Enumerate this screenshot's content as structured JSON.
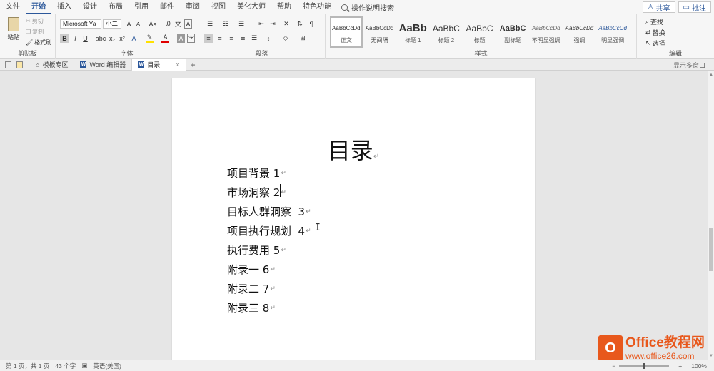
{
  "menu": {
    "tabs": [
      "文件",
      "开始",
      "插入",
      "设计",
      "布局",
      "引用",
      "邮件",
      "审阅",
      "视图",
      "美化大师",
      "帮助",
      "特色功能"
    ],
    "active_tab": "开始",
    "search_label": "操作说明搜索",
    "share_label": "共享",
    "comment_label": "批注"
  },
  "ribbon": {
    "clipboard": {
      "label": "剪贴板",
      "paste": "粘贴",
      "cut": "剪切",
      "copy": "复制",
      "format_painter": "格式刷"
    },
    "font": {
      "label": "字体",
      "family": "Microsoft Ya",
      "size": "小二",
      "aa": "Aa",
      "a_grow": "A",
      "a_shrink": "A"
    },
    "paragraph": {
      "label": "段落"
    },
    "styles": {
      "label": "样式",
      "items": [
        {
          "sample": "AaBbCcDd",
          "name": "正文"
        },
        {
          "sample": "AaBbCcDd",
          "name": "无间隔"
        },
        {
          "sample": "AaBb",
          "name": "标题 1"
        },
        {
          "sample": "AaBbC",
          "name": "标题 2"
        },
        {
          "sample": "AaBbC",
          "name": "标题"
        },
        {
          "sample": "AaBbC",
          "name": "副标题"
        },
        {
          "sample": "AaBbCcDd",
          "name": "不明显强调"
        },
        {
          "sample": "AaBbCcDd",
          "name": "强调"
        },
        {
          "sample": "AaBbCcDd",
          "name": "明显强调"
        }
      ],
      "selected": "正文"
    },
    "editing": {
      "label": "编辑",
      "find": "查找",
      "replace": "替换",
      "select": "选择"
    }
  },
  "tabbar": {
    "templates": "模板专区",
    "word_editor": "Word 编辑器",
    "current": "目录",
    "multi_window": "显示多窗口"
  },
  "document": {
    "title": "目录",
    "entries": [
      "项目背景 1",
      "市场洞察 2",
      "目标人群洞察  3",
      "项目执行规划  4",
      "执行费用 5",
      "附录一 6",
      "附录二 7",
      "附录三 8"
    ],
    "para_mark": "↵"
  },
  "status": {
    "page": "第 1 页，共 1 页",
    "words": "43 个字",
    "language": "英语(美国)",
    "zoom": "100%"
  },
  "watermark": {
    "brand": "Office教程网",
    "url": "www.office26.com"
  },
  "colors": {
    "accent": "#2b579a",
    "watermark": "#e8581c"
  }
}
